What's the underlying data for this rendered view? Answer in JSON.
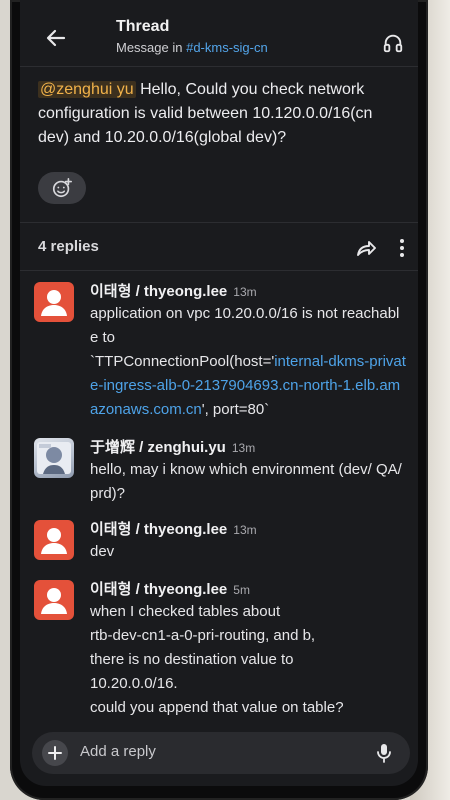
{
  "header": {
    "title": "Thread",
    "subtitle_prefix": "Message in ",
    "channel": "#d-kms-sig-cn"
  },
  "parent": {
    "mention": "@zenghui yu",
    "text": " Hello, Could you check network configuration is valid between 10.120.0.0/16(cn dev) and 10.20.0.0/16(global dev)?"
  },
  "replies": {
    "count_label": "4 replies"
  },
  "messages": [
    {
      "author": "이태형  / thyeong.lee",
      "time": "13m",
      "text_before": "application on vpc 10.20.0.0/16 is not reachable to\n`TTPConnectionPool(host='",
      "link": "internal-dkms-private-ingress-alb-0-2137904693.cn-north-1.elb.amazonaws.com.cn",
      "text_after": "', port=80`"
    },
    {
      "author": "于增辉  / zenghui.yu",
      "time": "13m",
      "text": "hello, may i know which environment (dev/ QA/prd)?"
    },
    {
      "author": "이태형  / thyeong.lee",
      "time": "13m",
      "text": "dev"
    },
    {
      "author": "이태형  / thyeong.lee",
      "time": "5m",
      "text": "when I checked tables about\nrtb-dev-cn1-a-0-pri-routing, and b,\nthere is no destination value to\n10.20.0.0/16.\ncould you append that value on table?"
    }
  ],
  "composer": {
    "placeholder": "Add a reply"
  },
  "colors": {
    "link": "#4ea3e8",
    "mention": "#f1b24a",
    "avatar_default": "#e4513a",
    "background": "#1a1b1e"
  }
}
